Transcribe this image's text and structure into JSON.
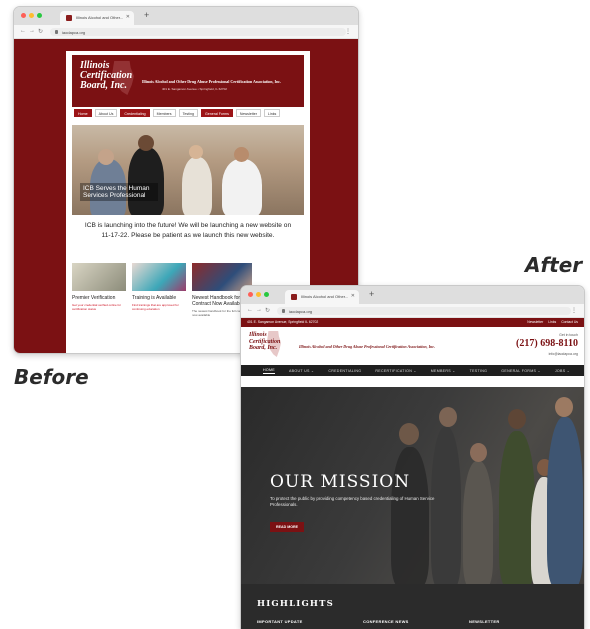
{
  "labels": {
    "before": "Before",
    "after": "After"
  },
  "before": {
    "tab_title": "Illinois Alcohol and Other...",
    "url": "iaodapca.org",
    "logo_lines": [
      "Illinois",
      "Certification",
      "Board, Inc."
    ],
    "org_name": "Illinois Alcohol and Other Drug Abuse Professional Certification Association, Inc.",
    "address": "401 E. Sangamon Avenue  •  Springfield, IL 62702",
    "nav": [
      "Home",
      "About Us",
      "Credentialing",
      "Members",
      "Testing",
      "General Forms",
      "Newsletter",
      "Links"
    ],
    "hero_caption": "ICB Serves the Human Services Professional",
    "message": "ICB is launching into the future! We will be launching a new website on 11-17-22. Please be patient as we launch this new website.",
    "cards": [
      {
        "title": "Premier Verification",
        "desc": "Get your credential verified online for certification status"
      },
      {
        "title": "Training is Available",
        "desc": "Find trainings that are approved for continuing education"
      },
      {
        "title": "Newest Handbook for Full Contract Now Available!",
        "desc": "The newest handbook for the full contract is now available"
      }
    ]
  },
  "after": {
    "tab_title": "Illinois Alcohol and Other...",
    "url": "iaodapca.org",
    "topbar_address": "401 E. Sangamon Avenue, Springfield IL 62702",
    "topbar_links": [
      "Newsletter",
      "Links",
      "Contact Us"
    ],
    "logo_lines": [
      "Illinois",
      "Certification",
      "Board, Inc."
    ],
    "org_name": "Illinois Alcohol and Other Drug Abuse Professional Certification Association, Inc.",
    "phone_label": "Get in touch",
    "phone": "(217) 698-8110",
    "email": "info@iaodapca.org",
    "nav": [
      "HOME",
      "ABOUT US ⌄",
      "CREDENTIALING",
      "RECERTIFICATION ⌄",
      "MEMBERS ⌄",
      "TESTING",
      "GENERAL FORMS ⌄",
      "JOBS ⌄"
    ],
    "hero_title": "OUR MISSION",
    "hero_desc": "To protect the public by providing competency based credentialing of Human Service Professionals.",
    "read_more": "READ MORE",
    "highlights_title": "HIGHLIGHTS",
    "highlight_cols": [
      "IMPORTANT UPDATE",
      "CONFERENCE NEWS",
      "NEWSLETTER"
    ]
  },
  "colors": {
    "brand": "#7b1113",
    "dark": "#2b2b2b"
  }
}
